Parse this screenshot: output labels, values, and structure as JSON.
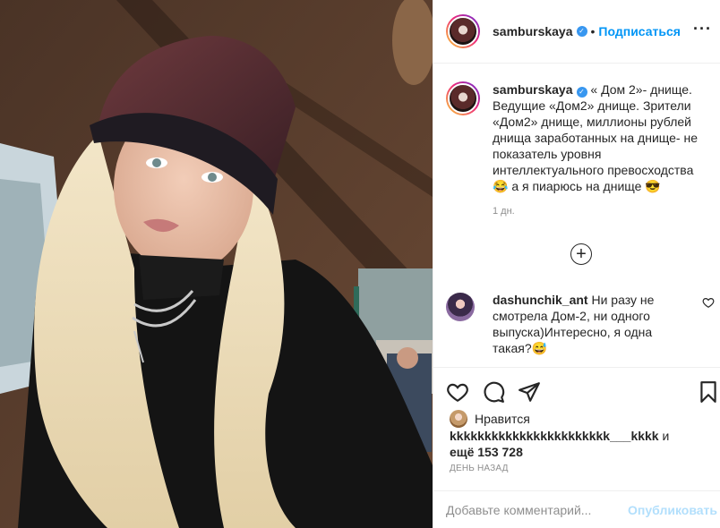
{
  "post": {
    "username": "samburskaya",
    "follow_label": "Подписаться",
    "dot": "•",
    "more_label": "···"
  },
  "caption": {
    "username": "samburskaya",
    "text": "« Дом 2»- днище. Ведущие «Дом2» днище. Зрители «Дом2» днище, миллионы рублей днища заработанных на днище- не показатель уровня интеллектуального превосходства",
    "emoji1": "😂",
    "text2": " а я пиарюсь на днище ",
    "emoji2": "😎",
    "time": "1 дн."
  },
  "load_more_icon": "+",
  "comment": {
    "username": "dashunchik_ant",
    "text": "Ни разу не смотрела Дом-2, ни одного выпуска)Интересно, я одна такая?",
    "emoji": "😅"
  },
  "likes": {
    "prefix": "Нравится",
    "username": "kkkkkkkkkkkkkkkkkkkkkkk___kkkk",
    "middle": " и",
    "count_text": "ещё 153 728"
  },
  "date_label": "ДЕНЬ НАЗАД",
  "add_comment": {
    "placeholder": "Добавьте комментарий...",
    "publish_label": "Опубликовать"
  },
  "icons": {
    "verified": "verified-badge-icon",
    "heart": "heart-icon",
    "comment": "comment-icon",
    "share": "share-icon",
    "save": "bookmark-icon"
  },
  "colors": {
    "accent": "#0095f6",
    "muted": "#8e8e8e",
    "publish_disabled": "#b2dffc",
    "border": "#efefef"
  }
}
